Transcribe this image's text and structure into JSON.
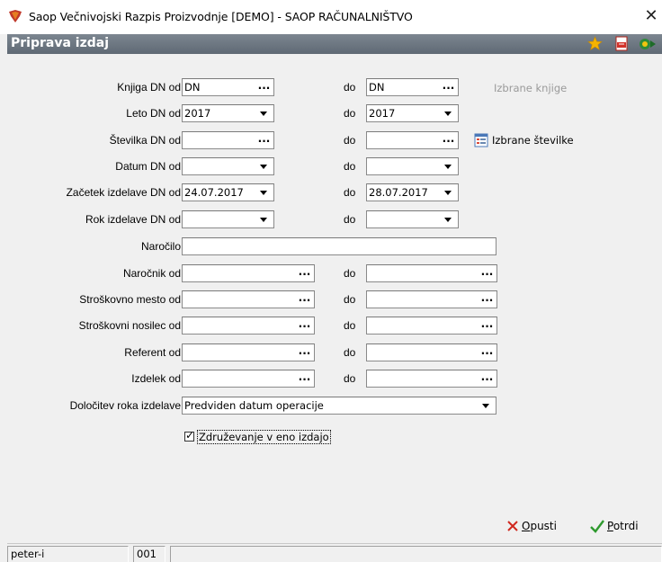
{
  "window": {
    "title": "Saop  Večnivojski Razpis Proizvodnje  [DEMO] - SAOP RAČUNALNIŠTVO"
  },
  "header": {
    "title": "Priprava izdaj"
  },
  "labels": {
    "knjiga": "Knjiga DN od",
    "leto": "Leto DN od",
    "stevilka": "Številka DN od",
    "datum": "Datum DN od",
    "zacetek": "Začetek izdelave DN od",
    "rok": "Rok izdelave DN od",
    "narocilo": "Naročilo",
    "narocnik": "Naročnik od",
    "strosmesto": "Stroškovno mesto od",
    "strosnosilec": "Stroškovni nosilec od",
    "referent": "Referent od",
    "izdelek": "Izdelek od",
    "dolocitev": "Določitev roka izdelave",
    "do": "do"
  },
  "fields": {
    "knjiga_od": "DN",
    "knjiga_do": "DN",
    "leto_od": "2017",
    "leto_do": "2017",
    "stevilka_od": "",
    "stevilka_do": "",
    "datum_od": "",
    "datum_do": "",
    "zacetek_od": "24.07.2017",
    "zacetek_do": "28.07.2017",
    "rok_od": "",
    "rok_do": "",
    "narocilo": "",
    "narocnik_od": "",
    "narocnik_do": "",
    "strosmesto_od": "",
    "strosmesto_do": "",
    "strosnosilec_od": "",
    "strosnosilec_do": "",
    "referent_od": "",
    "referent_do": "",
    "izdelek_od": "",
    "izdelek_do": "",
    "dolocitev": "Predviden datum operacije"
  },
  "links": {
    "izbrane_knjige": "Izbrane knjige",
    "izbrane_stevilke": "Izbrane številke"
  },
  "checkbox": {
    "label": "Združevanje v eno izdajo",
    "checked": true
  },
  "buttons": {
    "opusti": "Opusti",
    "potrdi": "Potrdi"
  },
  "status": {
    "user": "peter-i",
    "code": "001"
  },
  "icons": {
    "ellipsis": "..."
  }
}
